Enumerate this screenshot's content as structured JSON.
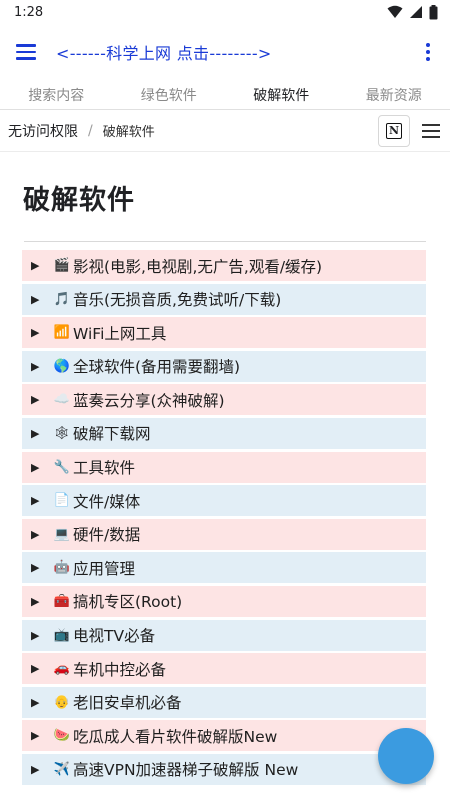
{
  "status": {
    "time": "1:28"
  },
  "appbar": {
    "title": "<------科学上网  点击-------->"
  },
  "tabs": [
    {
      "label": "搜索内容"
    },
    {
      "label": "绿色软件"
    },
    {
      "label": "破解软件"
    },
    {
      "label": "最新资源"
    }
  ],
  "breadcrumb": {
    "root": "无访问权限",
    "sep": "/",
    "current": "破解软件"
  },
  "notion_letter": "N",
  "page": {
    "title": "破解软件"
  },
  "items": [
    {
      "icon": "🎬",
      "label": "影视(电影,电视剧,无广告,观看/缓存)"
    },
    {
      "icon": "🎵",
      "label": "音乐(无损音质,免费试听/下载)"
    },
    {
      "icon": "📶",
      "label": "WiFi上网工具"
    },
    {
      "icon": "🌎",
      "label": "全球软件(备用需要翻墙)"
    },
    {
      "icon": "☁️",
      "label": "蓝奏云分享(众神破解)"
    },
    {
      "icon": "🕸",
      "label": "破解下载网"
    },
    {
      "icon": "🔧",
      "label": "工具软件"
    },
    {
      "icon": "📄",
      "label": "文件/媒体"
    },
    {
      "icon": "💻",
      "label": "硬件/数据"
    },
    {
      "icon": "🤖",
      "label": "应用管理"
    },
    {
      "icon": "🧰",
      "label": "搞机专区(Root)"
    },
    {
      "icon": "📺",
      "label": "电视TV必备"
    },
    {
      "icon": "🚗",
      "label": "车机中控必备"
    },
    {
      "icon": "👴",
      "label": "老旧安卓机必备"
    },
    {
      "icon": "🍉",
      "label": "吃瓜成人看片软件破解版New"
    },
    {
      "icon": "✈️",
      "label": "高速VPN加速器梯子破解版 New"
    }
  ],
  "colors": {
    "accent": "#1a3bd6",
    "row_pink": "#fde4e4",
    "row_blue": "#e2eef6",
    "fab": "#3b9be0"
  }
}
